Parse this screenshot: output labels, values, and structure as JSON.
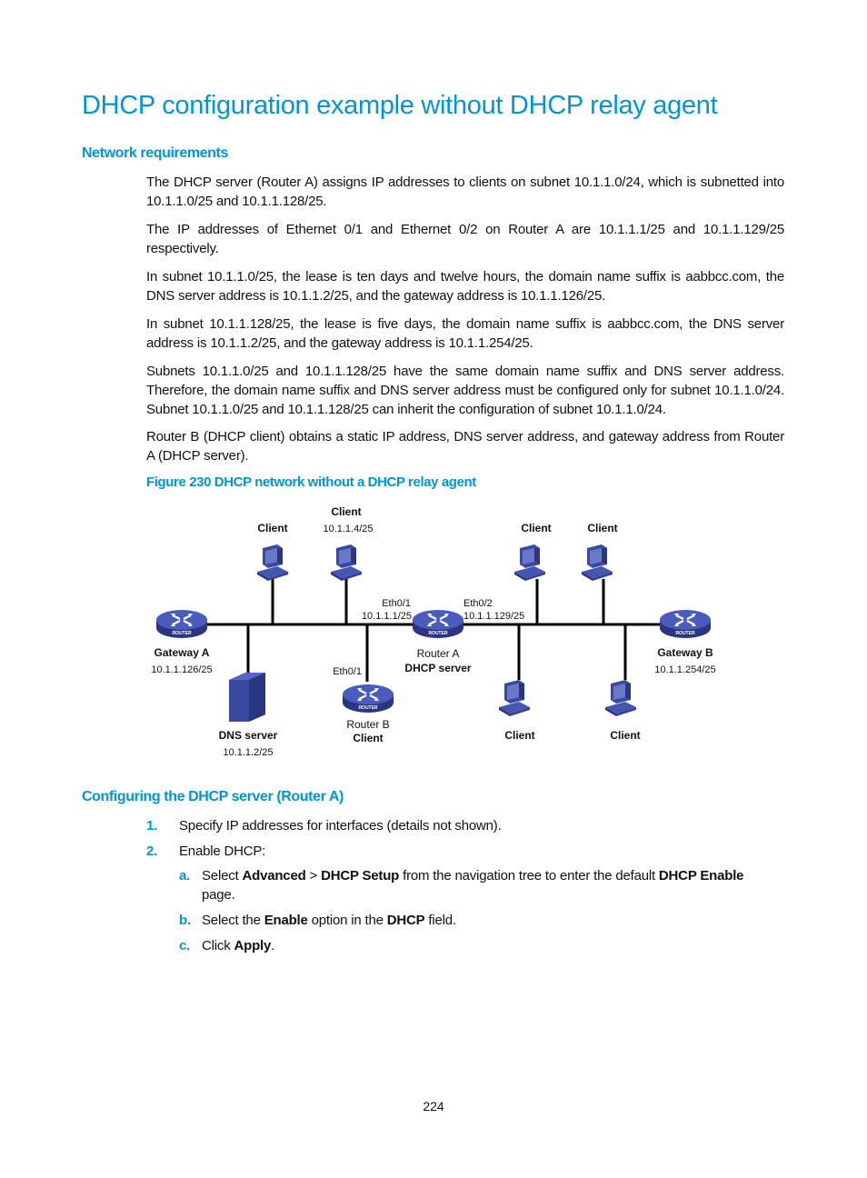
{
  "title": "DHCP configuration example without DHCP relay agent",
  "section1": {
    "heading": "Network requirements",
    "paragraphs": [
      "The DHCP server (Router A) assigns IP addresses to clients on subnet 10.1.1.0/24, which is subnetted into 10.1.1.0/25 and 10.1.1.128/25.",
      "The IP addresses of Ethernet 0/1 and Ethernet 0/2 on Router A are 10.1.1.1/25 and 10.1.1.129/25 respectively.",
      "In subnet 10.1.1.0/25, the lease is ten days and twelve hours, the domain name suffix is aabbcc.com, the DNS server address is 10.1.1.2/25, and the gateway address is 10.1.1.126/25.",
      "In subnet 10.1.1.128/25, the lease is five days, the domain name suffix is aabbcc.com, the DNS server address is 10.1.1.2/25, and the gateway address is 10.1.1.254/25.",
      "Subnets 10.1.1.0/25 and 10.1.1.128/25 have the same domain name suffix and DNS server address. Therefore, the domain name suffix and DNS server address must be configured only for subnet 10.1.1.0/24. Subnet 10.1.1.0/25 and 10.1.1.128/25 can inherit the configuration of subnet 10.1.1.0/24.",
      "Router B (DHCP client) obtains a static IP address, DNS server address, and gateway address from Router A (DHCP server)."
    ],
    "figure_caption": "Figure 230 DHCP network without a DHCP relay agent"
  },
  "diagram": {
    "client_left1": "Client",
    "client_left2": "Client",
    "client_left2_ip": "10.1.1.4/25",
    "client_right1": "Client",
    "client_right2": "Client",
    "client_bottom1": "Client",
    "client_bottom2": "Client",
    "gateway_a": "Gateway A",
    "gateway_a_ip": "10.1.1.126/25",
    "gateway_b": "Gateway B",
    "gateway_b_ip": "10.1.1.254/25",
    "router_a_eth1": "Eth0/1",
    "router_a_eth1_ip": "10.1.1.1/25",
    "router_a_eth2": "Eth0/2",
    "router_a_eth2_ip": "10.1.1.129/25",
    "router_a_name": "Router A",
    "router_a_role": "DHCP server",
    "router_b_eth": "Eth0/1",
    "router_b_name": "Router B",
    "router_b_role": "Client",
    "dns_server": "DNS server",
    "dns_server_ip": "10.1.1.2/25",
    "router_badge": "ROUTER"
  },
  "section2": {
    "heading": "Configuring the DHCP server (Router A)",
    "steps": [
      {
        "num": "1.",
        "text": "Specify IP addresses for interfaces (details not shown)."
      },
      {
        "num": "2.",
        "text": "Enable DHCP:"
      }
    ],
    "substeps": [
      {
        "num": "a.",
        "pre": "Select ",
        "b1": "Advanced",
        "mid1": " > ",
        "b2": "DHCP Setup",
        "mid2": " from the navigation tree to enter the default ",
        "b3": "DHCP Enable",
        "post": " page."
      },
      {
        "num": "b.",
        "pre": "Select the ",
        "b1": "Enable",
        "mid1": " option in the ",
        "b2": "DHCP",
        "post": " field."
      },
      {
        "num": "c.",
        "pre": "Click ",
        "b1": "Apply",
        "post": "."
      }
    ]
  },
  "page_number": "224",
  "colors": {
    "accent": "#0096d6",
    "device": "#3a4aa0"
  }
}
